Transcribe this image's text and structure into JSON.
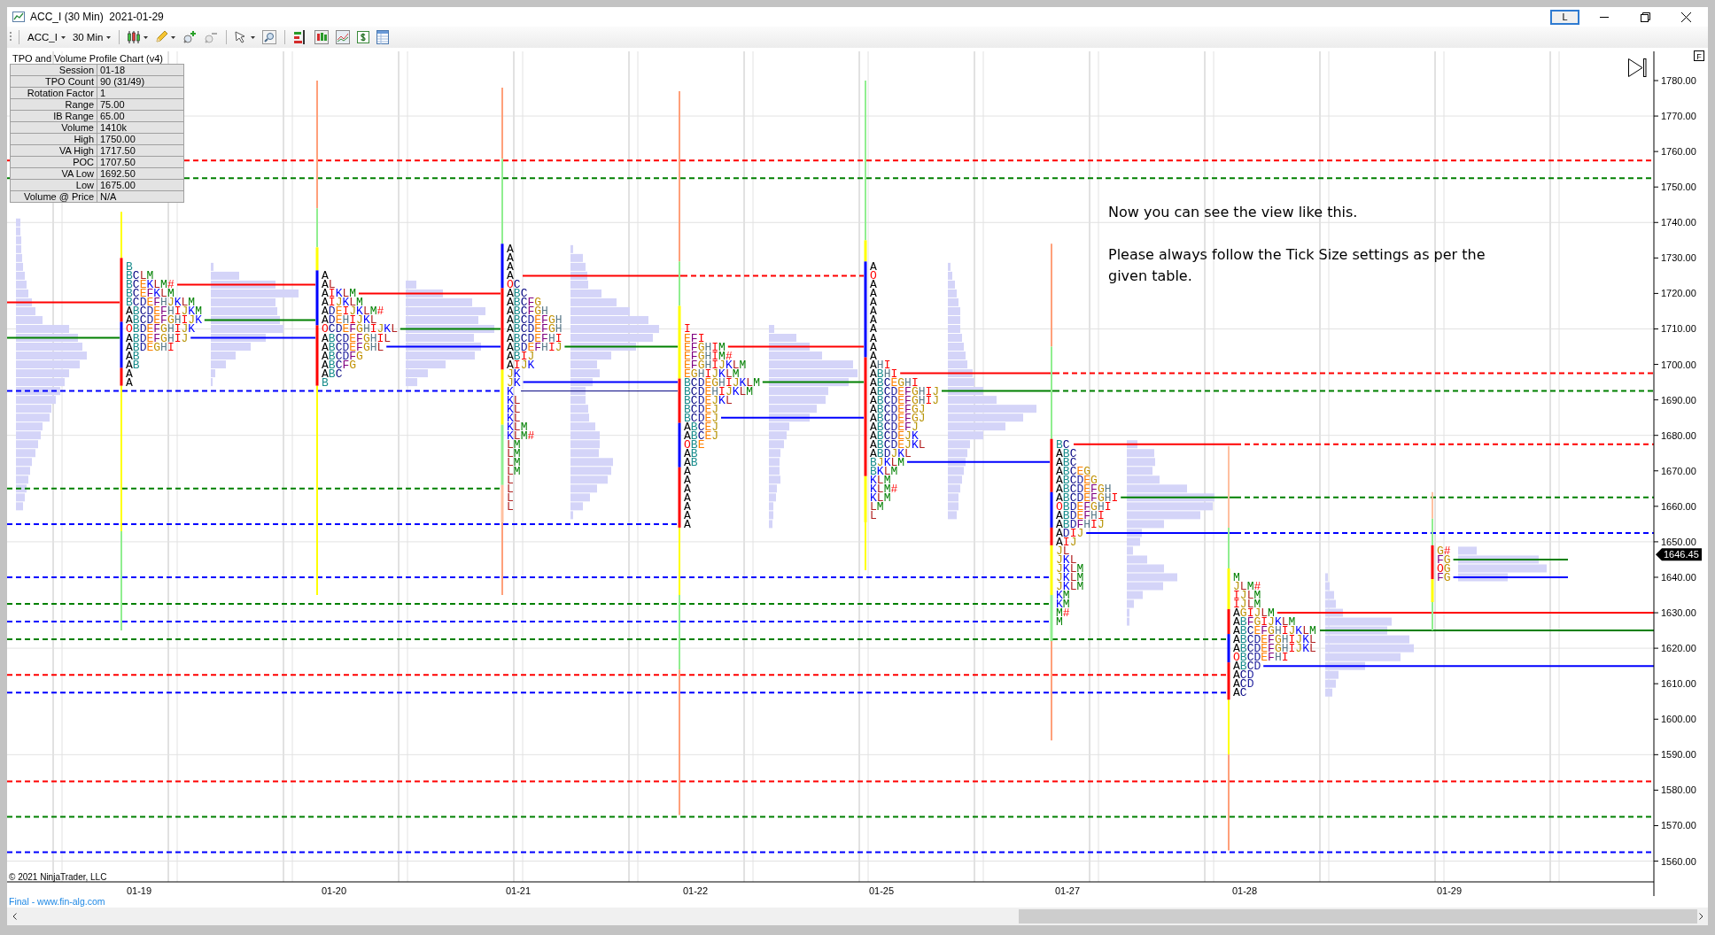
{
  "window": {
    "title": "ACC_I (30 Min)  2021-01-29",
    "link_button": "L"
  },
  "toolbar": {
    "instrument": "ACC_I",
    "interval": "30 Min"
  },
  "chart": {
    "indicator_title": "TPO and Volume Profile Chart (v4)",
    "stats": [
      {
        "label": "Session",
        "value": "01-18"
      },
      {
        "label": "TPO Count",
        "value": "90 (31/49)"
      },
      {
        "label": "Rotation Factor",
        "value": "1"
      },
      {
        "label": "Range",
        "value": "75.00"
      },
      {
        "label": "IB Range",
        "value": "65.00"
      },
      {
        "label": "Volume",
        "value": "1410k"
      },
      {
        "label": "High",
        "value": "1750.00"
      },
      {
        "label": "VA High",
        "value": "1717.50"
      },
      {
        "label": "POC",
        "value": "1707.50"
      },
      {
        "label": "VA Low",
        "value": "1692.50"
      },
      {
        "label": "Low",
        "value": "1675.00"
      },
      {
        "label": "Volume @ Price",
        "value": "N/A"
      }
    ],
    "note": [
      "Now you can see the view like this.",
      "Please always follow the Tick Size settings as per the given table."
    ],
    "profiles": [
      {
        "rows": [
          "B",
          "BCLM",
          "BCEKLM#",
          "BCEFKLM",
          "BCDEFHJKLM",
          "ABCDEFHIJKM",
          "ABCDEFGHIJK",
          "OBDEFGHIJK",
          "ABDEFGHIJ",
          "ABDEGHI",
          "AB",
          "AB",
          "A",
          "A"
        ]
      },
      {
        "rows": [
          "A",
          "AL",
          "AIKLM",
          "AIJKLM",
          "ADEIJKLM#",
          "ADEHIJKL",
          "OCDEFGHIJKL",
          "ABCDEFGHIL",
          "ABCDEFGHL",
          "ABCDFG",
          "ABCFG",
          "ABC",
          "B"
        ]
      },
      {
        "rows": [
          "A",
          "A",
          "A",
          "A",
          "OC",
          "ABC",
          "ABCFG",
          "ABCFGH",
          "ABCDEFGH",
          "ABCDEFGH",
          "ABCDEFHI",
          "ABDEFHIJ",
          "ABIJ",
          "AIJK",
          "JK",
          "JK",
          "K",
          "KL",
          "KL",
          "KL",
          "KLM",
          "KLM#",
          "LM",
          "LM",
          "LM",
          "LM",
          "L",
          "L",
          "L",
          "L"
        ]
      },
      {
        "rows": [
          "I",
          "EFI",
          "EFGHIM",
          "EFGHIM#",
          "EFGHIJKLM",
          "EGHIJKLM",
          "BCDEGHIJKLM",
          "BCDEHIJKLM",
          "BCDEJKL",
          "BCDEJ",
          "BCDEJ",
          "ABCEJ",
          "ABCEJ",
          "OBE",
          "AB",
          "AB",
          "A",
          "A",
          "A",
          "A",
          "A",
          "A",
          "A"
        ]
      },
      {
        "rows": [
          "A",
          "O",
          "A",
          "A",
          "A",
          "A",
          "A",
          "A",
          "A",
          "A",
          "A",
          "AHI",
          "ABHI",
          "ABCEGHI",
          "ABCDEFGHIJ",
          "ABCDEFGHIJ",
          "ABCDEFGJ",
          "ABCDEFGJ",
          "ABCDEFJ",
          "ABCDEJK",
          "ABCDEJKL",
          "ABDJKL",
          "BJKLM",
          "BKLM",
          "KLM",
          "KLM#",
          "KLM",
          "LM",
          "L"
        ]
      },
      {
        "rows": [
          "BC",
          "ABC",
          "ABC",
          "ABCEG",
          "ABCDEG",
          "ABCDEFGH",
          "ABCDEFGHI",
          "OBDEFGHI",
          "ABDEFHI",
          "ABDFHIJ",
          "ADIJ",
          "AIJ",
          "JL",
          "JKL",
          "JKLM",
          "JKLM",
          "JKLM",
          "KM",
          "KM",
          "M#",
          "M"
        ]
      },
      {
        "rows": [
          "M",
          "JLM#",
          "IJLM",
          "IJLM",
          "AGIJLM",
          "ABFGIJKLM",
          "ABCEFGHIJKLM",
          "ABCDEFGHIJKL",
          "ABCDEFGHIJKL",
          "OBCDEFHI",
          "ABCD",
          "ACD",
          "ACD",
          "AC"
        ]
      },
      {
        "rows": [
          "G#",
          "FG",
          "OG",
          "FG"
        ]
      }
    ],
    "price_labels": [
      "1780.00",
      "1770.00",
      "1760.00",
      "1750.00",
      "1740.00",
      "1730.00",
      "1720.00",
      "1710.00",
      "1700.00",
      "1690.00",
      "1680.00",
      "1670.00",
      "1660.00",
      "1650.00",
      "1640.00",
      "1630.00",
      "1620.00",
      "1610.00",
      "1600.00",
      "1590.00",
      "1580.00",
      "1570.00",
      "1560.00"
    ],
    "last_price": "1646.45",
    "date_labels": [
      "01-19",
      "01-20",
      "01-21",
      "01-22",
      "01-25",
      "01-27",
      "01-28",
      "01-29"
    ],
    "copyright": "© 2021 NinjaTrader, LLC",
    "corner_label": "F"
  },
  "footer": {
    "link": "Final - www.fin-alg.com"
  }
}
